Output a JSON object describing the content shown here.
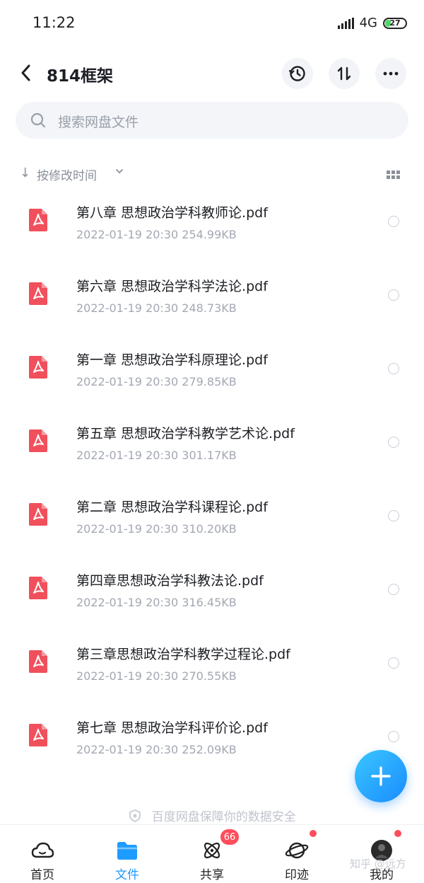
{
  "status": {
    "time": "11:22",
    "network": "4G",
    "battery": "27",
    "battery_level": 0.27
  },
  "header": {
    "title": "814框架"
  },
  "search": {
    "placeholder": "搜索网盘文件"
  },
  "sort": {
    "label": "按修改时间"
  },
  "files": [
    {
      "name": "第八章 思想政治学科教师论.pdf",
      "meta": "2022-01-19  20:30   254.99KB"
    },
    {
      "name": "第六章 思想政治学科学法论.pdf",
      "meta": "2022-01-19  20:30   248.73KB"
    },
    {
      "name": "第一章  思想政治学科原理论.pdf",
      "meta": "2022-01-19  20:30   279.85KB"
    },
    {
      "name": "第五章 思想政治学科教学艺术论.pdf",
      "meta": "2022-01-19  20:30   301.17KB"
    },
    {
      "name": "第二章 思想政治学科课程论.pdf",
      "meta": "2022-01-19  20:30   310.20KB"
    },
    {
      "name": "第四章思想政治学科教法论.pdf",
      "meta": "2022-01-19  20:30   316.45KB"
    },
    {
      "name": "第三章思想政治学科教学过程论.pdf",
      "meta": "2022-01-19  20:30   270.55KB"
    },
    {
      "name": "第七章 思想政治学科评价论.pdf",
      "meta": "2022-01-19  20:30   252.09KB"
    }
  ],
  "footer": {
    "secure_text": "百度网盘保障你的数据安全",
    "watermark": "知乎 @远方"
  },
  "tabs": [
    {
      "label": "首页",
      "icon": "cloud-icon"
    },
    {
      "label": "文件",
      "icon": "folder-icon"
    },
    {
      "label": "共享",
      "icon": "atom-icon",
      "badge": "66"
    },
    {
      "label": "印迹",
      "icon": "planet-icon"
    },
    {
      "label": "我的",
      "icon": "avatar-icon"
    }
  ],
  "colors": {
    "accent": "#1e9bff",
    "pdf": "#f0505c",
    "badge": "#ff4d5c"
  }
}
